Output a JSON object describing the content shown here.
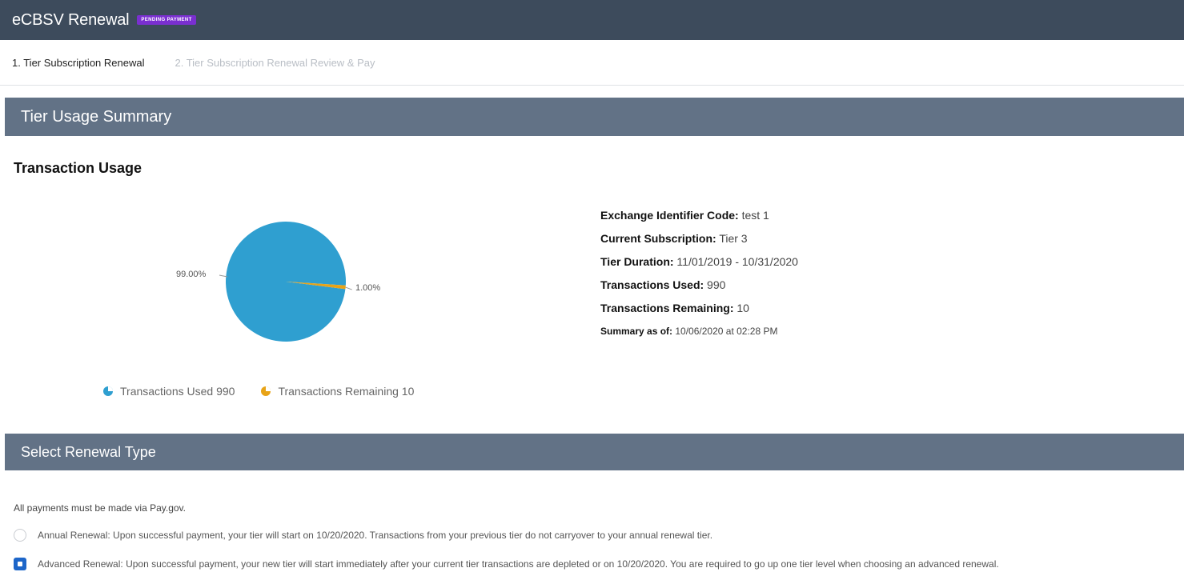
{
  "app": {
    "title": "eCBSV Renewal",
    "status_badge": "PENDING PAYMENT"
  },
  "steps": [
    {
      "label": "1. Tier Subscription Renewal",
      "active": true
    },
    {
      "label": "2. Tier Subscription Renewal Review & Pay",
      "active": false
    }
  ],
  "sections": {
    "usage_summary": "Tier Usage Summary",
    "renewal_type": "Select Renewal Type"
  },
  "usage": {
    "heading": "Transaction Usage",
    "details": [
      {
        "label": "Exchange Identifier Code:",
        "value": "test 1"
      },
      {
        "label": "Current Subscription:",
        "value": "Tier 3"
      },
      {
        "label": "Tier Duration:",
        "value": "11/01/2019 - 10/31/2020"
      },
      {
        "label": "Transactions Used:",
        "value": "990"
      },
      {
        "label": "Transactions Remaining:",
        "value": "10"
      },
      {
        "label": "Summary as of:",
        "value": "10/06/2020 at 02:28 PM"
      }
    ]
  },
  "chart_data": {
    "type": "pie",
    "categories": [
      "Transactions Used 990",
      "Transactions Remaining 10"
    ],
    "values": [
      990,
      10
    ],
    "percent_labels": [
      "99.00%",
      "1.00%"
    ],
    "colors": [
      "#2f9fd0",
      "#e8a317"
    ],
    "legend_position": "bottom"
  },
  "renewal": {
    "note": "All payments must be made via Pay.gov.",
    "options": [
      {
        "label": "Annual Renewal: Upon successful payment, your tier will start on 10/20/2020. Transactions from your previous tier do not carryover to your annual renewal tier.",
        "selected": false
      },
      {
        "label": "Advanced Renewal: Upon successful payment, your new tier will start immediately after your current tier transactions are depleted or on 10/20/2020. You are required to go up one tier level when choosing an advanced renewal.",
        "selected": true
      }
    ]
  }
}
